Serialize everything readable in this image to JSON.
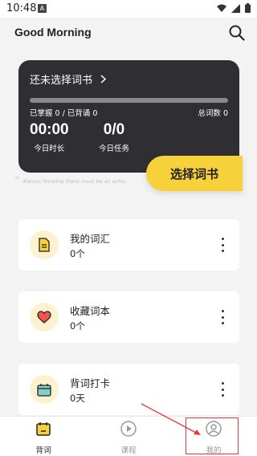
{
  "status_bar": {
    "time": "10:48",
    "notice_icon": "A"
  },
  "header": {
    "greeting": "Good Morning"
  },
  "book_card": {
    "choose_label": "还未选择词书",
    "progress": 0,
    "mastered_text": "已掌握 0 / 已背诵 0",
    "total_text": "总词数 0",
    "time_value": "00:00",
    "time_label": "今日时长",
    "task_value": "0/0",
    "task_label": "今日任务",
    "select_button": "选择词书"
  },
  "quote": "Always thinking there must be an echo.",
  "cards": [
    {
      "title": "我的词汇",
      "count": "0个",
      "icon": "document-icon"
    },
    {
      "title": "收藏词本",
      "count": "0个",
      "icon": "heart-icon"
    },
    {
      "title": "背词打卡",
      "count": "0天",
      "icon": "calendar-icon"
    }
  ],
  "nav": {
    "items": [
      {
        "label": "背词",
        "icon": "calendar-icon",
        "active": true
      },
      {
        "label": "课程",
        "icon": "play-icon",
        "active": false
      },
      {
        "label": "我的",
        "icon": "user-icon",
        "active": false
      }
    ]
  },
  "colors": {
    "accent": "#f7d13b",
    "dark_card": "#2e2e33",
    "annotation": "#e53935",
    "icon_bg": "#fdf2cf"
  }
}
